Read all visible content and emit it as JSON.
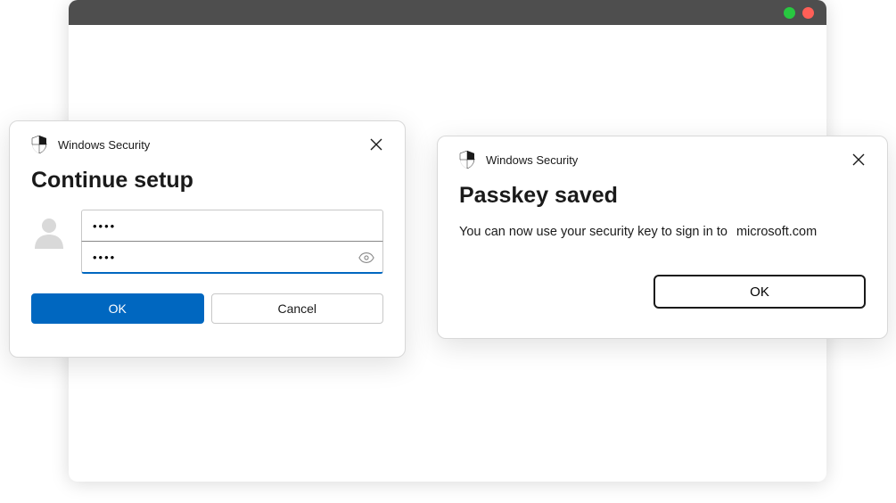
{
  "dialog_left": {
    "window_title": "Windows Security",
    "heading": "Continue setup",
    "username_value": "••••",
    "password_value": "••••",
    "ok_label": "OK",
    "cancel_label": "Cancel"
  },
  "dialog_right": {
    "window_title": "Windows Security",
    "heading": "Passkey saved",
    "body_prefix": "You can now use your security key to sign in to",
    "body_domain": "microsoft.com",
    "ok_label": "OK"
  }
}
